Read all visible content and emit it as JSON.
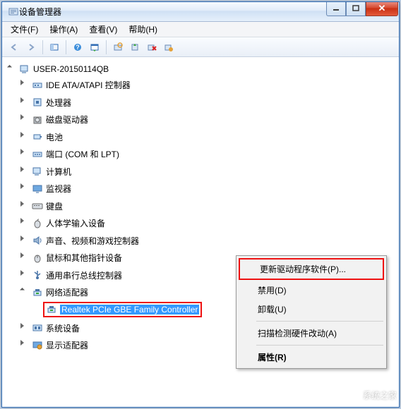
{
  "window": {
    "title": "设备管理器"
  },
  "menu": {
    "file": "文件(F)",
    "action": "操作(A)",
    "view": "查看(V)",
    "help": "帮助(H)"
  },
  "root": {
    "label": "USER-20150114QB"
  },
  "nodes": [
    {
      "label": "IDE ATA/ATAPI 控制器",
      "icon": "ide"
    },
    {
      "label": "处理器",
      "icon": "cpu"
    },
    {
      "label": "磁盘驱动器",
      "icon": "disk"
    },
    {
      "label": "电池",
      "icon": "battery"
    },
    {
      "label": "端口 (COM 和 LPT)",
      "icon": "port"
    },
    {
      "label": "计算机",
      "icon": "computer"
    },
    {
      "label": "监视器",
      "icon": "monitor"
    },
    {
      "label": "键盘",
      "icon": "keyboard"
    },
    {
      "label": "人体学输入设备",
      "icon": "hid"
    },
    {
      "label": "声音、视频和游戏控制器",
      "icon": "sound"
    },
    {
      "label": "鼠标和其他指针设备",
      "icon": "mouse"
    },
    {
      "label": "通用串行总线控制器",
      "icon": "usb"
    },
    {
      "label": "网络适配器",
      "icon": "network",
      "expanded": true
    },
    {
      "label": "系统设备",
      "icon": "system"
    },
    {
      "label": "显示适配器",
      "icon": "display"
    }
  ],
  "selected_device": {
    "label": "Realtek PCIe GBE Family Controller"
  },
  "context_menu": {
    "update": "更新驱动程序软件(P)...",
    "disable": "禁用(D)",
    "uninstall": "卸载(U)",
    "scan": "扫描检测硬件改动(A)",
    "properties": "属性(R)"
  },
  "watermark": "系统之家"
}
